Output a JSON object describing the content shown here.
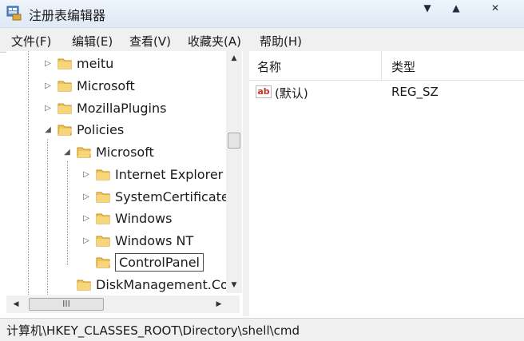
{
  "window": {
    "title": "注册表编辑器",
    "minimize": "▼",
    "maximize": "▲",
    "close": "✕"
  },
  "menu": [
    "文件(F)",
    "编辑(E)",
    "查看(V)",
    "收藏夹(A)",
    "帮助(H)"
  ],
  "tree": {
    "nodes": [
      {
        "label": "meitu",
        "expander": "▷"
      },
      {
        "label": "Microsoft",
        "expander": "▷"
      },
      {
        "label": "MozillaPlugins",
        "expander": "▷"
      },
      {
        "label": "Policies",
        "expander": "◢"
      },
      {
        "label": "Microsoft",
        "expander": "◢"
      },
      {
        "label": "Internet Explorer",
        "expander": "▷"
      },
      {
        "label": "SystemCertificates",
        "expander": "▷"
      },
      {
        "label": "Windows",
        "expander": "▷"
      },
      {
        "label": "Windows NT",
        "expander": "▷"
      },
      {
        "label": "ControlPanel",
        "expander": ""
      },
      {
        "label": "DiskManagement.Cor",
        "expander": ""
      }
    ],
    "hscroll_thumb_text": "III"
  },
  "list": {
    "columns": {
      "name": "名称",
      "type": "类型"
    },
    "rows": [
      {
        "name": "(默认)",
        "type": "REG_SZ",
        "icon_text": "ab"
      }
    ]
  },
  "status": {
    "path": "计算机\\HKEY_CLASSES_ROOT\\Directory\\shell\\cmd"
  },
  "colors": {
    "folder": "#f2c55c",
    "titlebar": "#dfe9f5",
    "chrome": "#f0f0f0"
  }
}
